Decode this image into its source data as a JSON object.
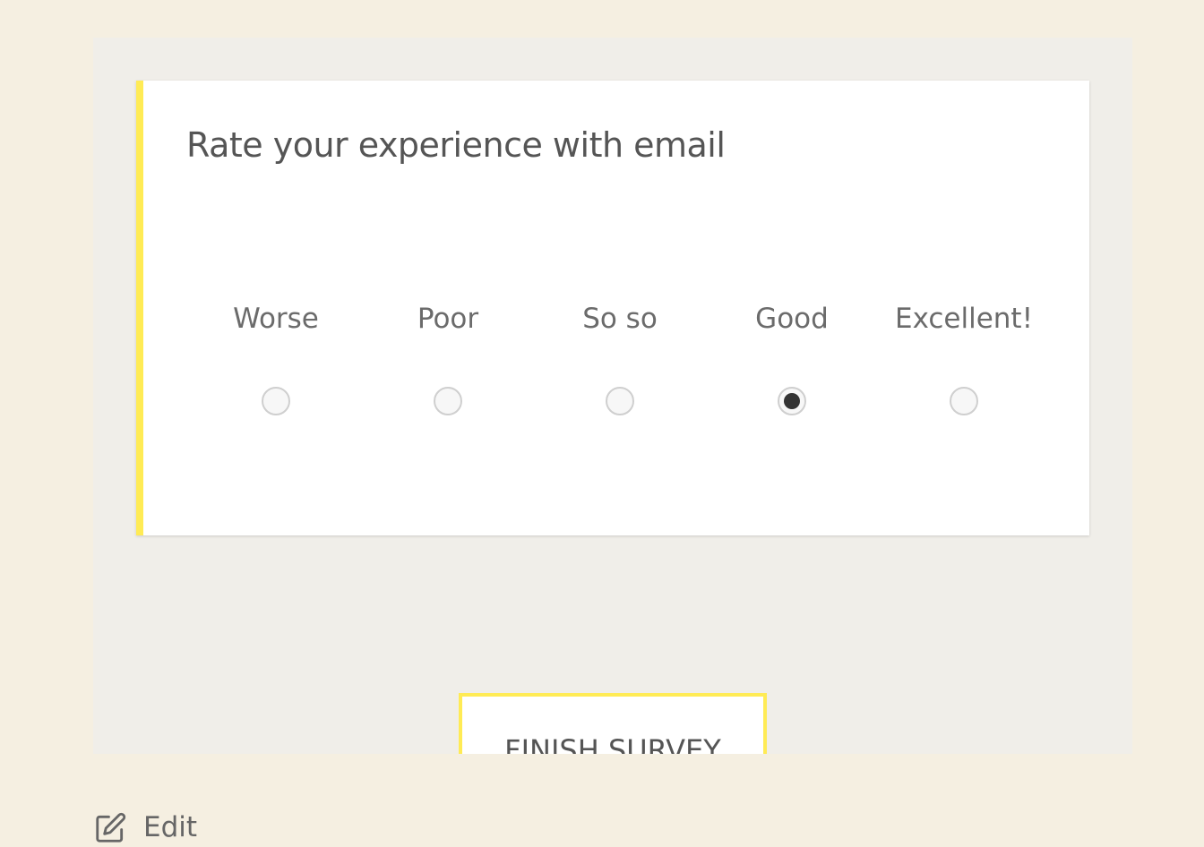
{
  "question": {
    "title": "Rate your experience with email",
    "options": [
      {
        "label": "Worse",
        "checked": false
      },
      {
        "label": "Poor",
        "checked": false
      },
      {
        "label": "So so",
        "checked": false
      },
      {
        "label": "Good",
        "checked": true
      },
      {
        "label": "Excellent!",
        "checked": false
      }
    ],
    "selected": "Good"
  },
  "footer": {
    "finish_label": "FINISH SURVEY",
    "edit_label": "Edit",
    "edit_icon": "pencil-square-icon"
  },
  "colors": {
    "page_background": "#f5efe1",
    "panel_background": "#f0eee9",
    "accent": "#ffeb55",
    "text": "#555555",
    "radio_checked": "#333333"
  }
}
